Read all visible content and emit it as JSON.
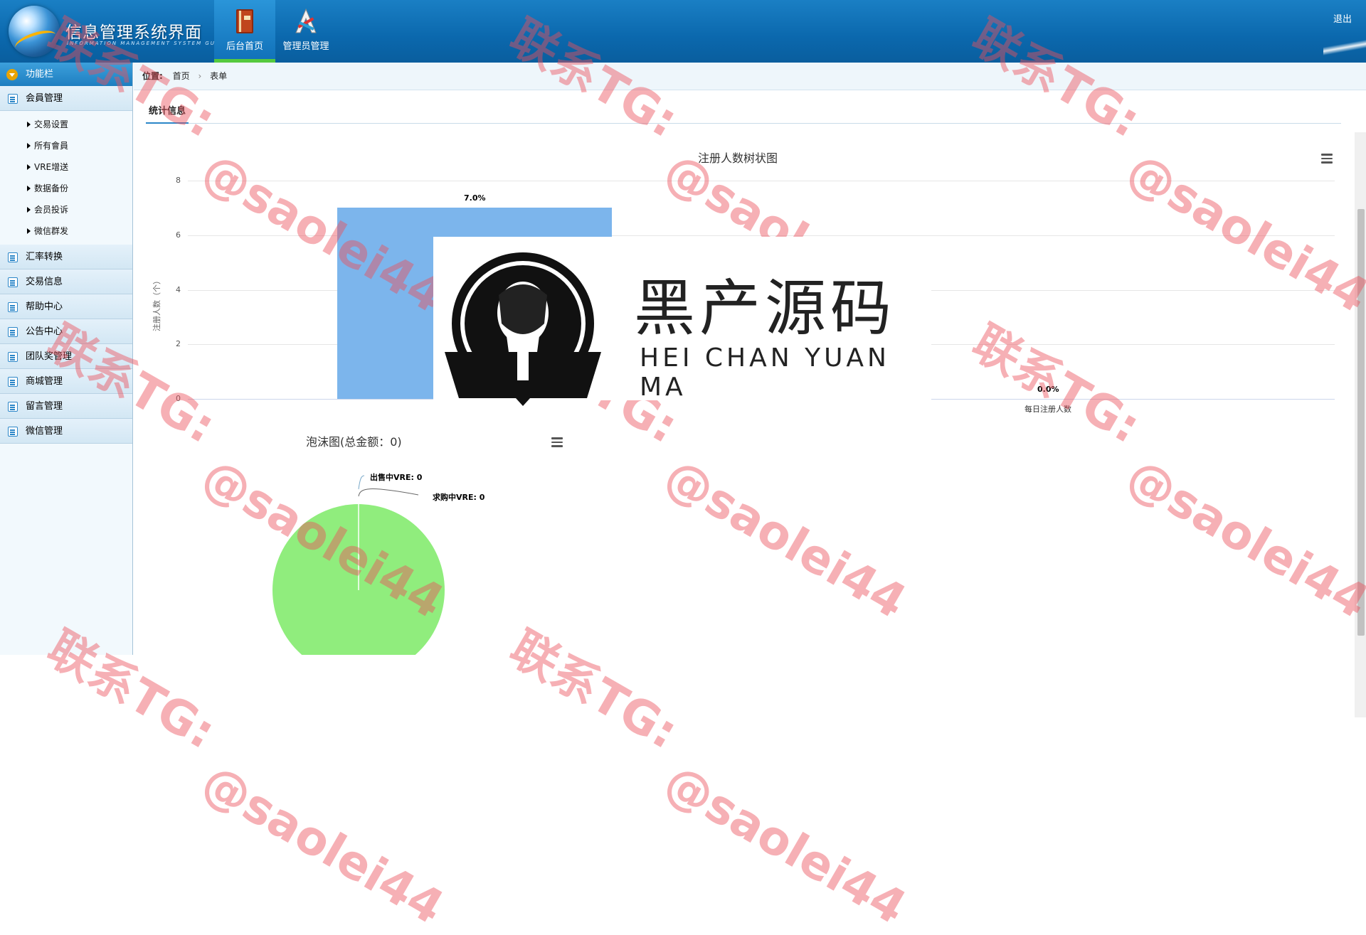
{
  "header": {
    "title": "信息管理系统界面",
    "subtitle": "INFORMATION MANAGEMENT SYSTEM GUI",
    "tabs": [
      {
        "label": "后台首页",
        "icon": "book-icon"
      },
      {
        "label": "管理员管理",
        "icon": "tools-icon"
      }
    ],
    "logout": "退出"
  },
  "sidebar": {
    "title": "功能栏",
    "groups": [
      {
        "label": "会員管理",
        "icon": "list-icon"
      },
      {
        "label": "汇率转换",
        "icon": "chat-icon"
      },
      {
        "label": "交易信息",
        "icon": "list-icon"
      },
      {
        "label": "帮助中心",
        "icon": "edit-icon"
      },
      {
        "label": "公告中心",
        "icon": "edit-icon"
      },
      {
        "label": "团队奖管理",
        "icon": "calendar-icon"
      },
      {
        "label": "商城管理",
        "icon": "calendar-icon"
      },
      {
        "label": "留言管理",
        "icon": "edit-icon"
      },
      {
        "label": "微信管理",
        "icon": "chat-icon"
      }
    ],
    "sub_items": [
      "交易设置",
      "所有會員",
      "VRE增送",
      "数据备份",
      "会员投诉",
      "微信群发"
    ]
  },
  "breadcrumb": {
    "label": "位置:",
    "items": [
      "首页",
      "表单"
    ],
    "separator": "›"
  },
  "stat_tab": "统计信息",
  "chart_data": [
    {
      "type": "bar",
      "title": "注册人数树状图",
      "ylabel": "注册人数（个）",
      "ylim": [
        0,
        8
      ],
      "yticks": [
        "0",
        "2",
        "4",
        "6",
        "8"
      ],
      "categories": [
        "",
        "每日注册人数"
      ],
      "values": [
        7,
        0
      ],
      "data_labels": [
        "7.0%",
        "0.0%"
      ],
      "color": "#7cb5ec"
    },
    {
      "type": "pie",
      "title": "泡沫图(总金额：0)",
      "slices": [
        {
          "label": "出售中VRE: 0",
          "value": 0
        },
        {
          "label": "求购中VRE: 0",
          "value": 0
        }
      ],
      "color": "#90ed7d"
    }
  ],
  "watermark": {
    "line1": "联系TG:",
    "line2": "@saolei44"
  },
  "brand": {
    "name_cn": "黑产源码",
    "name_en": "HEI CHAN YUAN MA"
  },
  "colors": {
    "header": "#0b68ad",
    "bar": "#7cb5ec",
    "pie": "#90ed7d",
    "active_tab_underline": "#55c93e",
    "watermark": "#eb505a"
  }
}
